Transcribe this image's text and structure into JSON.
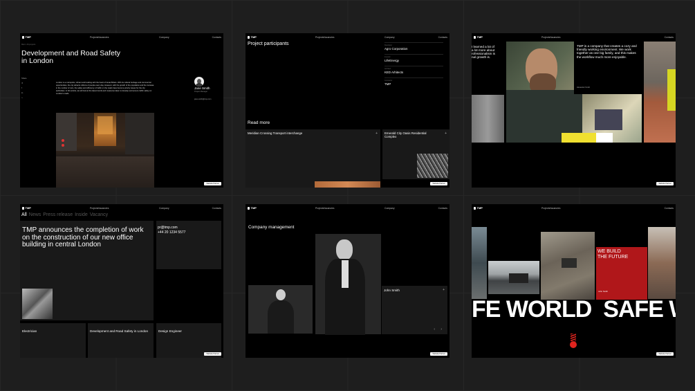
{
  "nav": {
    "logo": "TMP",
    "projects": "Projects",
    "vacancies": "Vacancies",
    "company": "Company",
    "contacts": "Contacts",
    "work_btn": "Website Partner"
  },
  "p1": {
    "crumb": "Main   /   All projects",
    "title_l1": "Development and Road Safety",
    "title_l2": "in London",
    "share": "Share",
    "body": "London is a metropolis, vibrant and bustling with the heart of Great Britain. With its cultural heritage and commercial opportunities, the city attracts millions of people every day. However, with the growth of the population and the increase in the number of cars, the safety and efficiency of traffic on the roads have become priority issues for the city authorities. In this article, we will look at the latest trends and measures taken to develop and ensure traffic safety on London's roads.",
    "person_name": "Jane Smith",
    "person_role": "Project Manager",
    "person_email": "jane.smith@tmp.com"
  },
  "p2": {
    "heading": "Project participants",
    "participants": [
      {
        "role": "Developer",
        "name": "Agro Corporation"
      },
      {
        "role": "Investor",
        "name": "LifeEnergy"
      },
      {
        "role": "Architect",
        "name": "KED Arhitects"
      },
      {
        "role": "Contractor",
        "name": "TMP"
      }
    ],
    "read_more": "Read more",
    "card1": "Meridian Crossing Transport interchange",
    "card2_l1": "Emerald City Oasis Residential",
    "card2_l2": "Complex"
  },
  "p3": {
    "left_l1": "I learned a lot of",
    "left_l2": "a lot more about",
    "left_l3": "rofessionalism is",
    "left_l4": "nal growth is.",
    "quote": "TMP is a company that creates a cozy and friendly working environment. We work together as one big family, and this makes the workflow much more enjoyable.",
    "author": "Alexander Smith"
  },
  "p4": {
    "filters": [
      "All",
      "News",
      "Press release",
      "Inside",
      "Vacancy"
    ],
    "headline_l1": "TMP announces the completion of work",
    "headline_l2": "on the construction of our new office",
    "headline_l3": "building in central London",
    "email": "pr@tmp.com",
    "phone": "+44 20 1234 5577",
    "cards": [
      "Electrician",
      "Development and Road Safety in London",
      "Design Engineer"
    ]
  },
  "p5": {
    "heading": "Company management",
    "name": "John Smith"
  },
  "p6": {
    "red_l1": "WE BUILD",
    "red_l2": "THE FUTURE",
    "red_name": "John Smith",
    "marquee": "FE WORLD  SAFE WO"
  }
}
